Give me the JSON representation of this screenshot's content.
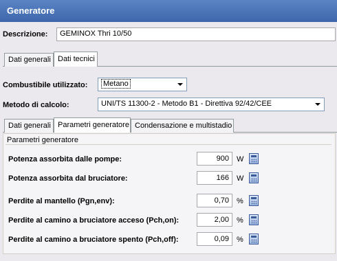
{
  "window": {
    "title": "Generatore"
  },
  "descrizione": {
    "label": "Descrizione:",
    "value": "GEMINOX Thri 10/50"
  },
  "main_tabs": [
    {
      "label": "Dati generali",
      "active": false
    },
    {
      "label": "Dati tecnici",
      "active": true
    }
  ],
  "combustibile": {
    "label": "Combustibile utilizzato:",
    "value": "Metano"
  },
  "metodo": {
    "label": "Metodo di calcolo:",
    "value": "UNI/TS 11300-2 - Metodo B1 - Direttiva 92/42/CEE"
  },
  "sub_tabs": [
    {
      "label": "Dati generali",
      "active": false
    },
    {
      "label": "Parametri generatore",
      "active": true
    },
    {
      "label": "Condensazione e multistadio",
      "active": false
    }
  ],
  "group": {
    "title": "Parametri generatore"
  },
  "params": [
    {
      "label": "Potenza assorbita dalle pompe:",
      "value": "900",
      "unit": "W",
      "icon": "calculator-icon"
    },
    {
      "label": "Potenza assorbita dal bruciatore:",
      "value": "166",
      "unit": "W",
      "icon": "calculator-icon"
    },
    {
      "label": "Perdite al mantello (Pgn,env):",
      "value": "0,70",
      "unit": "%",
      "icon": "calculator-icon"
    },
    {
      "label": "Perdite al camino a bruciatore acceso (Pch,on):",
      "value": "2,00",
      "unit": "%",
      "icon": "calculator-icon"
    },
    {
      "label": "Perdite al camino a bruciatore spento (Pch,off):",
      "value": "0,09",
      "unit": "%",
      "icon": "calculator-icon"
    }
  ],
  "colors": {
    "titlebar": "#4a74b8",
    "background": "#ebe9ed"
  }
}
